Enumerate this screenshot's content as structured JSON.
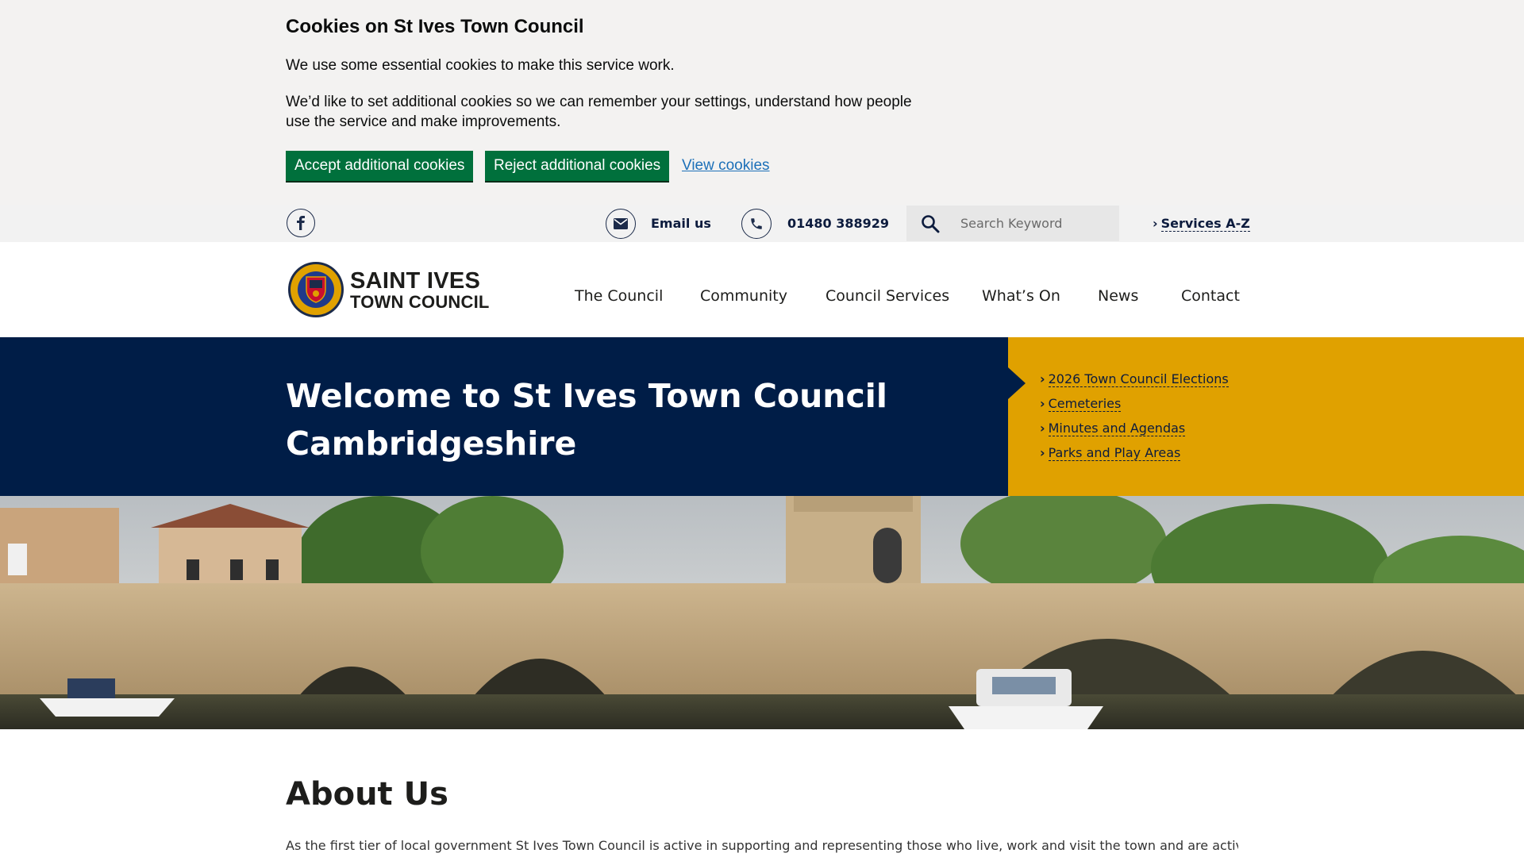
{
  "cookies": {
    "title": "Cookies on St Ives Town Council",
    "p1": "We use some essential cookies to make this service work.",
    "p2": "We’d like to set additional cookies so we can remember your settings, understand how people use the service and make improvements.",
    "accept": "Accept additional cookies",
    "reject": "Reject additional cookies",
    "view": "View cookies"
  },
  "utility": {
    "email": "Email us",
    "phone": "01480 388929",
    "search_placeholder": "Search Keyword",
    "services_az": "Services A-Z"
  },
  "brand": {
    "line1": "SAINT IVES",
    "line2": "TOWN COUNCIL"
  },
  "nav": [
    "The Council",
    "Community",
    "Council Services",
    "What’s On",
    "News",
    "Contact"
  ],
  "hero": {
    "line1": "Welcome to St Ives Town Council",
    "line2": "Cambridgeshire"
  },
  "quick_links": [
    "2026 Town Council Elections",
    "Cemeteries",
    "Minutes and Agendas",
    "Parks and Play Areas"
  ],
  "about": {
    "title": "About Us",
    "text": "As the first tier of local government St Ives Town Council is active in supporting and representing those who live, work and visit the town and are actively working"
  },
  "colors": {
    "cookie_bg": "#f3f2f1",
    "button_green": "#00703c",
    "navy": "#001d47",
    "gold": "#e0a100"
  }
}
